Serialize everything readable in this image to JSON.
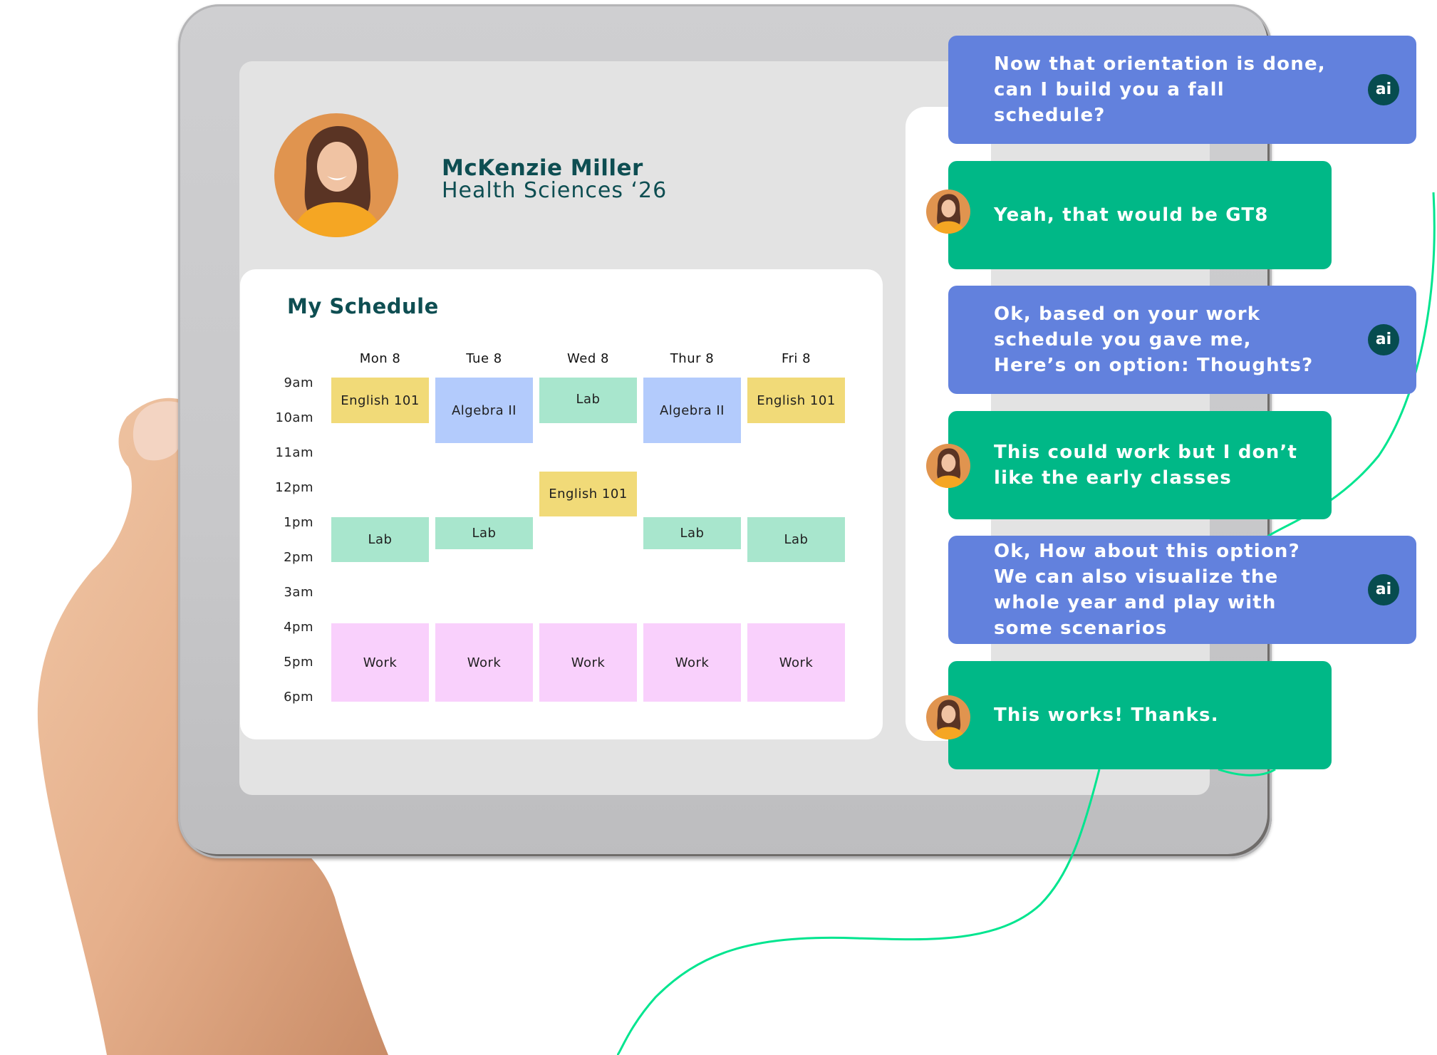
{
  "profile": {
    "name": "McKenzie Miller",
    "program": "Health Sciences ‘26",
    "avatar_icon": "student-portrait"
  },
  "schedule": {
    "title": "My Schedule",
    "days": [
      "Mon 8",
      "Tue 8",
      "Wed 8",
      "Thur 8",
      "Fri 8"
    ],
    "times": [
      "9am",
      "10am",
      "11am",
      "12pm",
      "1pm",
      "2pm",
      "3am",
      "4pm",
      "5pm",
      "6pm"
    ],
    "events": [
      {
        "day": "Mon 8",
        "label": "English 101",
        "type": "english"
      },
      {
        "day": "Tue 8",
        "label": "Algebra II",
        "type": "algebra"
      },
      {
        "day": "Wed 8",
        "label": "Lab",
        "type": "lab"
      },
      {
        "day": "Thur 8",
        "label": "Algebra II",
        "type": "algebra"
      },
      {
        "day": "Fri 8",
        "label": "English 101",
        "type": "english"
      },
      {
        "day": "Wed 8",
        "label": "English 101",
        "type": "english"
      },
      {
        "day": "Mon 8",
        "label": "Lab",
        "type": "lab"
      },
      {
        "day": "Tue 8",
        "label": "Lab",
        "type": "lab"
      },
      {
        "day": "Thur 8",
        "label": "Lab",
        "type": "lab"
      },
      {
        "day": "Fri 8",
        "label": "Lab",
        "type": "lab"
      },
      {
        "day": "Mon 8",
        "label": "Work",
        "type": "work"
      },
      {
        "day": "Tue 8",
        "label": "Work",
        "type": "work"
      },
      {
        "day": "Wed 8",
        "label": "Work",
        "type": "work"
      },
      {
        "day": "Thur 8",
        "label": "Work",
        "type": "work"
      },
      {
        "day": "Fri 8",
        "label": "Work",
        "type": "work"
      }
    ],
    "colors": {
      "english": "#f1da78",
      "algebra": "#b3cbfc",
      "lab": "#a8e6cd",
      "work": "#f9d0fc"
    }
  },
  "chat": {
    "ai_badge_label": "ai",
    "colors": {
      "ai": "#6281dd",
      "user": "#00b887",
      "badge": "#064c4f",
      "curve": "#00e58f"
    },
    "messages": [
      {
        "sender": "ai",
        "text": "Now that orientation is done, can I build you a fall schedule?"
      },
      {
        "sender": "user",
        "text": "Yeah, that would be GT8"
      },
      {
        "sender": "ai",
        "text": "Ok, based on your work schedule you gave me, Here’s on option: Thoughts?"
      },
      {
        "sender": "user",
        "text": "This could work but I don’t like the early classes"
      },
      {
        "sender": "ai",
        "text": "Ok, How about this option? We can also visualize the whole year and play with some scenarios"
      },
      {
        "sender": "user",
        "text": "This works! Thanks."
      }
    ]
  }
}
